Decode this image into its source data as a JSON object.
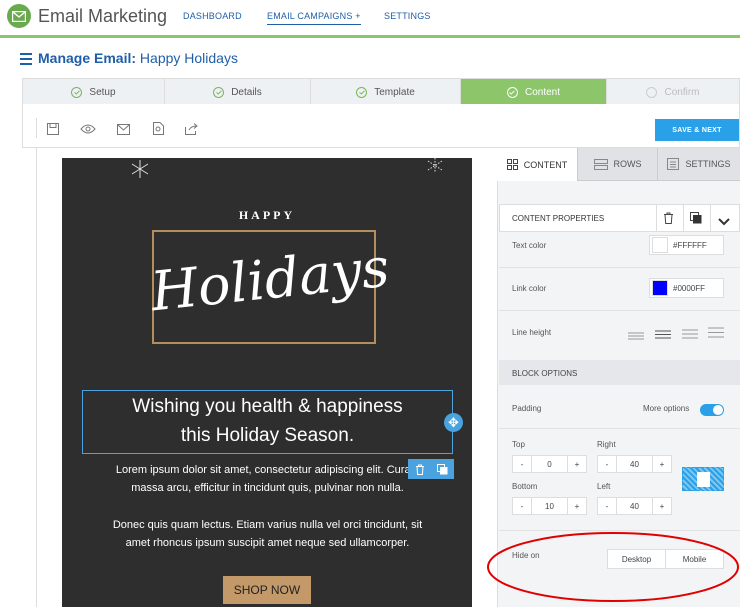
{
  "app": {
    "title": "Email Marketing"
  },
  "nav": [
    {
      "label": "DASHBOARD"
    },
    {
      "label": "EMAIL CAMPAIGNS +"
    },
    {
      "label": "SETTINGS"
    }
  ],
  "page": {
    "heading_prefix": "Manage Email:",
    "heading_name": "Happy Holidays"
  },
  "steps": [
    {
      "label": "Setup",
      "state": "done"
    },
    {
      "label": "Details",
      "state": "done"
    },
    {
      "label": "Template",
      "state": "done"
    },
    {
      "label": "Content",
      "state": "active"
    },
    {
      "label": "Confirm",
      "state": "pending"
    }
  ],
  "toolbar": {
    "icons": [
      "save-icon",
      "preview-eye-icon",
      "email-icon",
      "file-search-icon",
      "share-icon"
    ],
    "save_next": "SAVE & NEXT"
  },
  "email": {
    "happy": "HAPPY",
    "holidays": "Holidays",
    "wish_line1": "Wishing you health & happiness",
    "wish_line2": "this Holiday Season.",
    "para1_line1": "Lorem ipsum dolor sit amet, consectetur adipiscing elit. Curabi",
    "para1_line2": "massa arcu, efficitur in tincidunt quis, pulvinar non nulla.",
    "para2_line1": "Donec quis quam lectus. Etiam varius nulla vel orci tincidunt, sit",
    "para2_line2": "amet rhoncus ipsum suscipit amet neque sed ullamcorper.",
    "button": "SHOP NOW"
  },
  "panel": {
    "tabs": [
      {
        "label": "CONTENT",
        "icon": "grid-icon"
      },
      {
        "label": "ROWS",
        "icon": "rows-icon"
      },
      {
        "label": "SETTINGS",
        "icon": "settings-list-icon"
      }
    ],
    "content_properties": "CONTENT PROPERTIES",
    "text_color": {
      "label": "Text color",
      "value": "#FFFFFF"
    },
    "link_color": {
      "label": "Link color",
      "value": "#0000FF"
    },
    "line_height": {
      "label": "Line height"
    },
    "block_options": "BLOCK OPTIONS",
    "padding": {
      "label": "Padding",
      "more_options": "More options"
    },
    "top": {
      "label": "Top",
      "value": "0"
    },
    "right": {
      "label": "Right",
      "value": "40"
    },
    "bottom": {
      "label": "Bottom",
      "value": "10"
    },
    "left": {
      "label": "Left",
      "value": "40"
    },
    "stepper_minus": "-",
    "stepper_plus": "+",
    "hide_on": {
      "label": "Hide on",
      "options": [
        "Desktop",
        "Mobile"
      ]
    }
  },
  "colors": {
    "accent_green": "#8dc56a",
    "accent_blue": "#2aa0e8",
    "annotation_red": "#e00000",
    "email_bg": "#2e2e2e",
    "button_tan": "#c4996a"
  }
}
